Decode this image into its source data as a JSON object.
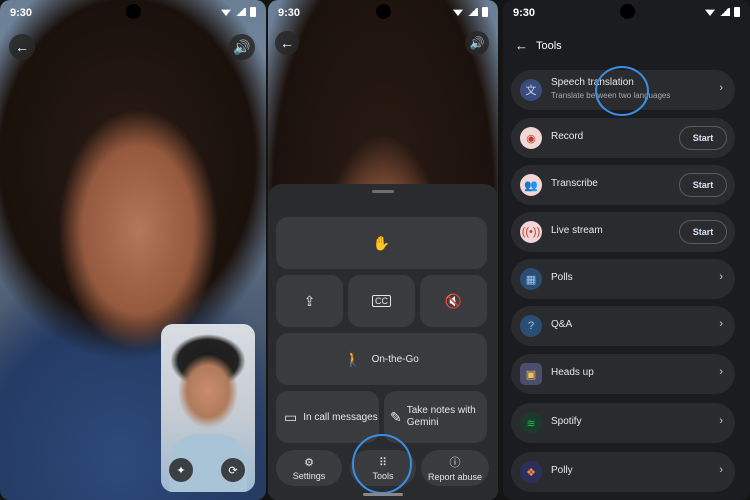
{
  "status_time": "9:30",
  "phone2": {
    "tiles": {
      "on_the_go": "On-the-Go",
      "in_call_messages": "In call messages",
      "take_notes": "Take notes with Gemini"
    },
    "bottom": {
      "settings": "Settings",
      "tools": "Tools",
      "report": "Report abuse"
    }
  },
  "phone3": {
    "title": "Tools",
    "start_label": "Start",
    "rows": [
      {
        "label": "Speech translation",
        "sub": "Translate between two languages",
        "icon": "translate-icon",
        "color": "#3b4b7a",
        "action": "chevron"
      },
      {
        "label": "Record",
        "icon": "record-icon",
        "color": "#f1d7d6",
        "action": "start"
      },
      {
        "label": "Transcribe",
        "icon": "transcribe-icon",
        "color": "#f1d7d6",
        "action": "start"
      },
      {
        "label": "Live stream",
        "icon": "live-stream-icon",
        "color": "#f1d7d6",
        "action": "start"
      },
      {
        "label": "Polls",
        "icon": "polls-icon",
        "color": "#2a4e73",
        "action": "chevron"
      },
      {
        "label": "Q&A",
        "icon": "qa-icon",
        "color": "#2a4e73",
        "action": "chevron"
      },
      {
        "label": "Heads up",
        "icon": "heads-up-icon",
        "color": "#4a4e6a",
        "action": "chevron"
      },
      {
        "label": "Spotify",
        "icon": "spotify-icon",
        "color": "#1b3a2a",
        "action": "chevron"
      },
      {
        "label": "Polly",
        "icon": "polly-icon",
        "color": "#2b2f5c",
        "action": "chevron"
      }
    ]
  },
  "colors": {
    "highlight": "#3a8ee6",
    "sheet": "#2a2b2e",
    "tile": "#3a3b3f"
  }
}
